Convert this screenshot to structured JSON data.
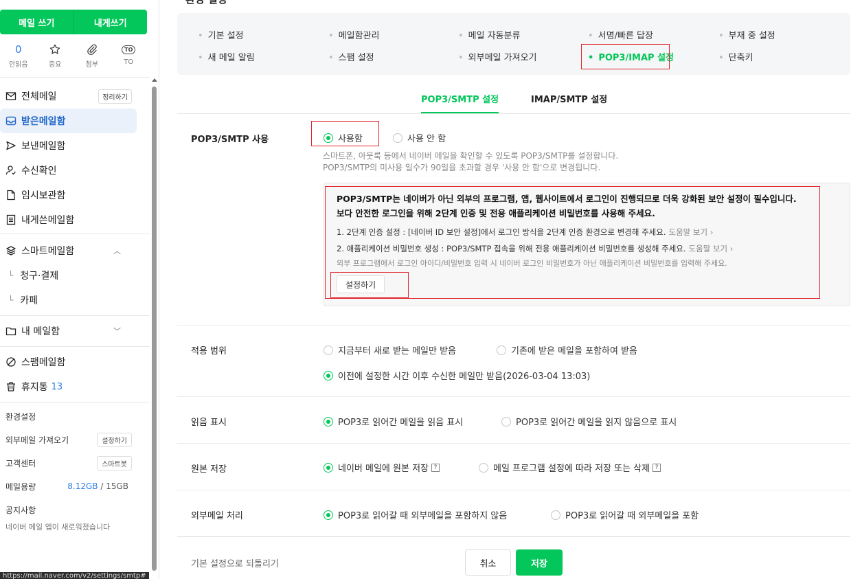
{
  "sidebar": {
    "compose_label": "메일 쓰기",
    "self_compose_label": "내게쓰기",
    "quick": [
      {
        "value": "0",
        "label": "안읽음"
      },
      {
        "value": "☆",
        "label": "중요"
      },
      {
        "value": "📎",
        "label": "첨부"
      },
      {
        "value": "TO",
        "label": "TO"
      }
    ],
    "all_mail": "전체메일",
    "all_mail_btn": "정리하기",
    "inbox": "받은메일함",
    "sent": "보낸메일함",
    "read_receipt": "수신확인",
    "drafts": "임시보관함",
    "self_mail": "내게쓴메일함",
    "smart": "스마트메일함",
    "smart_sub1": "청구·결제",
    "smart_sub2": "카페",
    "my_mail": "내 메일함",
    "spam": "스팸메일함",
    "trash": "휴지통",
    "trash_count": "13",
    "settings": "환경설정",
    "external": "외부메일 가져오기",
    "external_btn": "설정하기",
    "support": "고객센터",
    "support_btn": "스마트봇",
    "usage_label": "메일용량",
    "usage_used": "8.12GB",
    "usage_sep": " / ",
    "usage_total": "15GB",
    "notice": "공지사항",
    "notice_text": "네이버 메일 앱이 새로워졌습니다",
    "url": "https://mail.naver.com/v2/settings/smtp#"
  },
  "main": {
    "title": "환경 설정",
    "menu": [
      "기본 설정",
      "메일함관리",
      "메일 자동분류",
      "서명/빠른 답장",
      "부재 중 설정",
      "새 메일 알림",
      "스팸 설정",
      "외부메일 가져오기",
      "POP3/IMAP 설정",
      "단축키"
    ],
    "tabs": [
      "POP3/SMTP 설정",
      "IMAP/SMTP 설정"
    ],
    "use_label": "POP3/SMTP 사용",
    "use_on": "사용함",
    "use_off": "사용 안 함",
    "use_desc1": "스마트폰, 아웃룩 등에서 네이버 메일을 확인할 수 있도록 POP3/SMTP를 설정합니다.",
    "use_desc2": "POP3/SMTP의 미사용 일수가 90일을 초과할 경우 '사용 안 함'으로 변경됩니다.",
    "warn_head1": "POP3/SMTP는 네이버가 아닌 외부의 프로그램, 앱, 웹사이트에서 로그인이 진행되므로 더욱 강화된 보안 설정이 필수입니다.",
    "warn_head2": "보다 안전한 로그인을 위해 2단계 인증 및 전용 애플리케이션 비밀번호를 사용해 주세요.",
    "warn_line1": "1. 2단계 인증 설정 : [네이버 ID 보안 설정]에서 로그인 방식을 2단계 인증 환경으로 변경해 주세요.",
    "warn_line2": "2. 애플리케이션 비밀번호 생성 : POP3/SMTP 접속을 위해 전용 애플리케이션 비밀번호를 생성해 주세요.",
    "help_link": "도움말 보기 ›",
    "warn_small": "외부 프로그램에서 로그인 아이디/비밀번호 입력 시 네이버 로그인 비밀번호가 아닌 애플리케이션 비밀번호를 입력해 주세요.",
    "set_btn": "설정하기",
    "scope_label": "적용 범위",
    "scope_opt1": "지금부터 새로 받는 메일만 받음",
    "scope_opt2": "기존에 받은 메일을 포함하여 받음",
    "scope_opt3": "이전에 설정한 시간 이후 수신한 메일만 받음(2026-03-04 13:03)",
    "read_label": "읽음 표시",
    "read_opt1": "POP3로 읽어간 메일을 읽음 표시",
    "read_opt2": "POP3로 읽어간 메일을 읽지 않음으로 표시",
    "orig_label": "원본 저장",
    "orig_opt1": "네이버 메일에 원본 저장",
    "orig_opt2": "메일 프로그램 설정에 따라 저장 또는 삭제",
    "ext_label": "외부메일 처리",
    "ext_opt1": "POP3로 읽어갈 때 외부메일을 포함하지 않음",
    "ext_opt2": "POP3로 읽어갈 때 외부메일을 포함",
    "reset": "기본 설정으로 되돌리기",
    "cancel": "취소",
    "save": "저장"
  },
  "colors": {
    "accent": "#03c75a",
    "highlight": "#e0242c",
    "link": "#2b7de9"
  }
}
